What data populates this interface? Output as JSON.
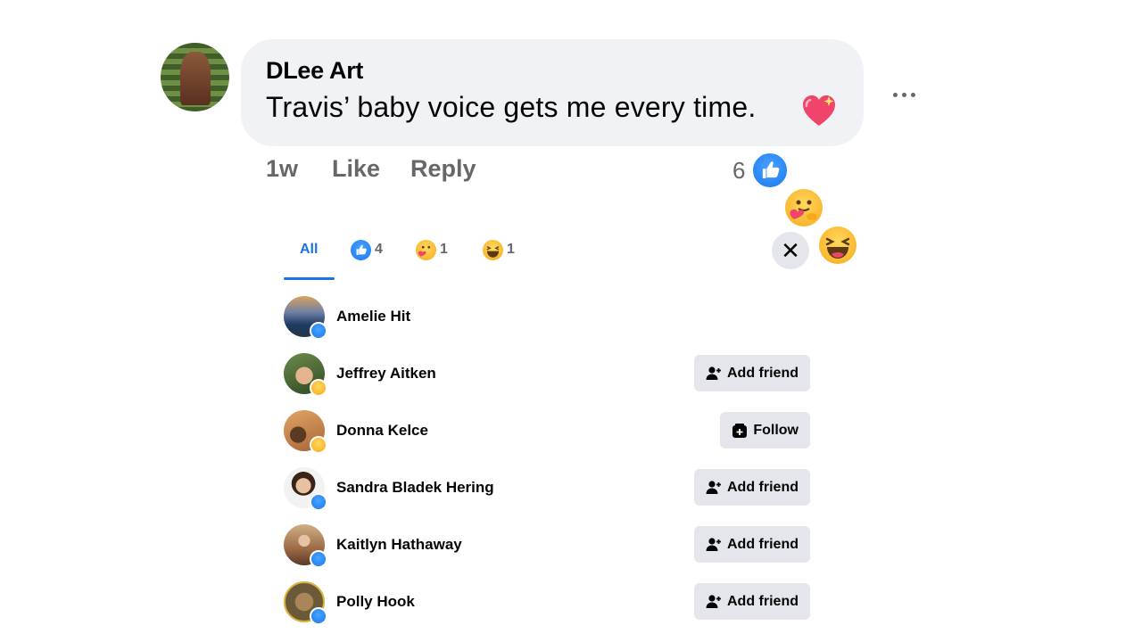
{
  "comment": {
    "author": "DLee Art",
    "text": "Travis’ baby voice gets me every time.",
    "time": "1w",
    "like_label": "Like",
    "reply_label": "Reply",
    "reaction_total": "6",
    "reaction_icons": [
      "like-icon",
      "care-icon",
      "haha-icon"
    ]
  },
  "reactions_panel": {
    "tabs": [
      {
        "label": "All",
        "active": true
      },
      {
        "icon": "like-icon",
        "count": "4"
      },
      {
        "icon": "care-icon",
        "count": "1"
      },
      {
        "icon": "haha-icon",
        "count": "1"
      }
    ],
    "people": [
      {
        "name": "Amelie Hit",
        "reaction": "like",
        "action": ""
      },
      {
        "name": "Jeffrey Aitken",
        "reaction": "haha",
        "action": "Add friend"
      },
      {
        "name": "Donna Kelce",
        "reaction": "care",
        "action": "Follow"
      },
      {
        "name": "Sandra Bladek Hering",
        "reaction": "like",
        "action": "Add friend"
      },
      {
        "name": "Kaitlyn Hathaway",
        "reaction": "like",
        "action": "Add friend"
      },
      {
        "name": "Polly Hook",
        "reaction": "like",
        "action": "Add friend"
      }
    ]
  },
  "colors": {
    "accent": "#1b74e4",
    "like": "#1778f2",
    "bubble": "#f0f2f5",
    "button": "#e4e6eb",
    "secondary_text": "#65676b"
  }
}
